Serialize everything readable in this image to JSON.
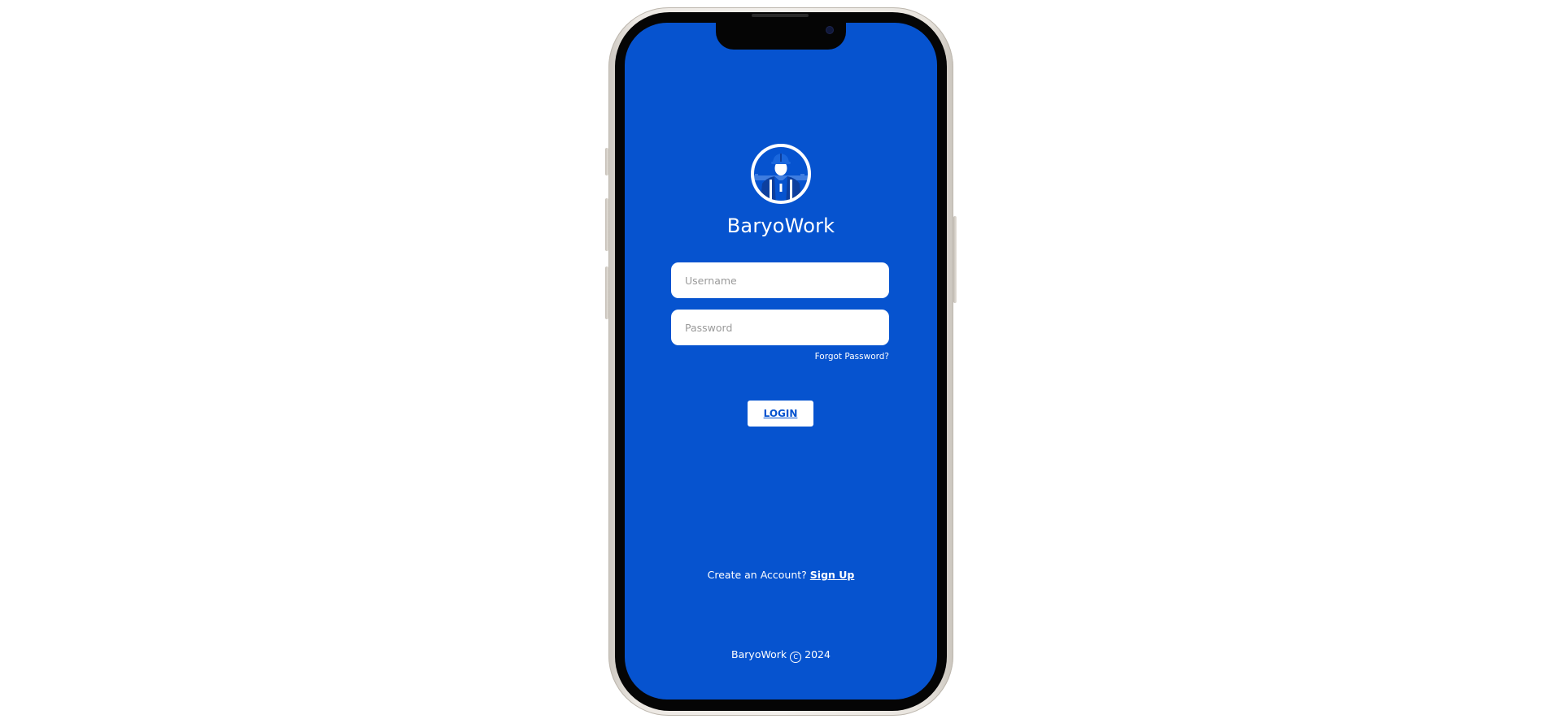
{
  "app": {
    "title": "BaryoWork"
  },
  "login_form": {
    "username_placeholder": "Username",
    "password_placeholder": "Password",
    "forgot_password_label": "Forgot Password?",
    "login_label": "LOGIN"
  },
  "signup": {
    "prompt": "Create an Account?",
    "link_label": "Sign Up"
  },
  "footer": {
    "brand": "BaryoWork",
    "copyright_symbol": "C",
    "year": "2024"
  },
  "icons": {
    "logo": "worker-helmet-logo-icon",
    "copyright": "copyright-icon"
  },
  "colors": {
    "brand_blue": "#0653cf",
    "white": "#ffffff",
    "phone_frame": "#ece8e3"
  }
}
